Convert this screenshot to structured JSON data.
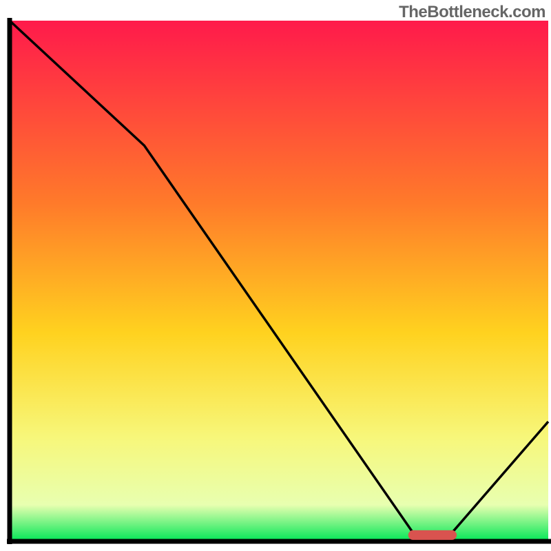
{
  "watermark": "TheBottleneck.com",
  "chart_data": {
    "type": "line",
    "title": "",
    "xlabel": "",
    "ylabel": "",
    "xlim": [
      0,
      100
    ],
    "ylim": [
      0,
      100
    ],
    "series": [
      {
        "name": "curve",
        "x": [
          0,
          25,
          75,
          82,
          100
        ],
        "y": [
          100,
          76,
          1.5,
          1.5,
          23
        ]
      }
    ],
    "marker": {
      "x_start": 74,
      "x_end": 83,
      "y": 1.2
    },
    "gradient_stops": [
      {
        "pct": 0,
        "color": "#ff1a4b"
      },
      {
        "pct": 35,
        "color": "#ff7a2a"
      },
      {
        "pct": 60,
        "color": "#ffd21f"
      },
      {
        "pct": 80,
        "color": "#f7f77a"
      },
      {
        "pct": 93,
        "color": "#e8ffb0"
      },
      {
        "pct": 100,
        "color": "#00e756"
      }
    ],
    "axis_color": "#000000",
    "line_color": "#000000",
    "marker_color": "#d9534f"
  }
}
